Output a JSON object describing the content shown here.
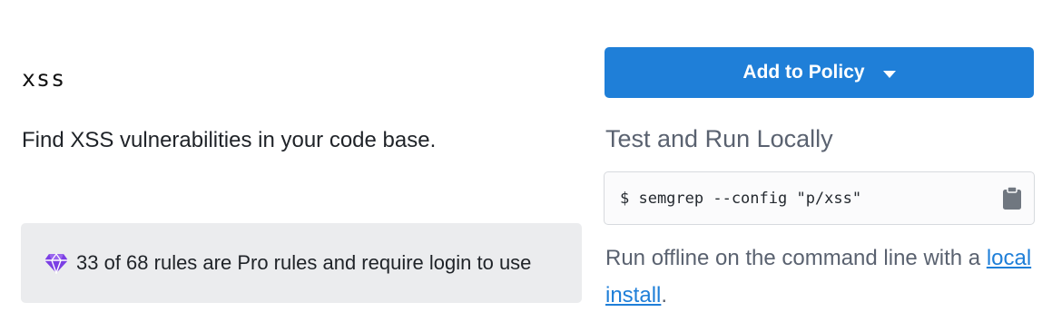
{
  "rule": {
    "title": "xss",
    "description": "Find XSS vulnerabilities in your code base."
  },
  "pro_notice": {
    "icon": "gem-icon",
    "text": "33 of 68 rules are Pro rules and require login to use",
    "icon_color": "#7b3fe4"
  },
  "actions": {
    "add_to_policy_label": "Add to Policy",
    "accent_color": "#1f7fd8"
  },
  "local": {
    "heading": "Test and Run Locally",
    "command": "$ semgrep --config \"p/xss\"",
    "copy_icon": "clipboard-icon",
    "offline_prefix": "Run offline on the command line with a",
    "offline_link": "local install",
    "offline_suffix": "."
  }
}
